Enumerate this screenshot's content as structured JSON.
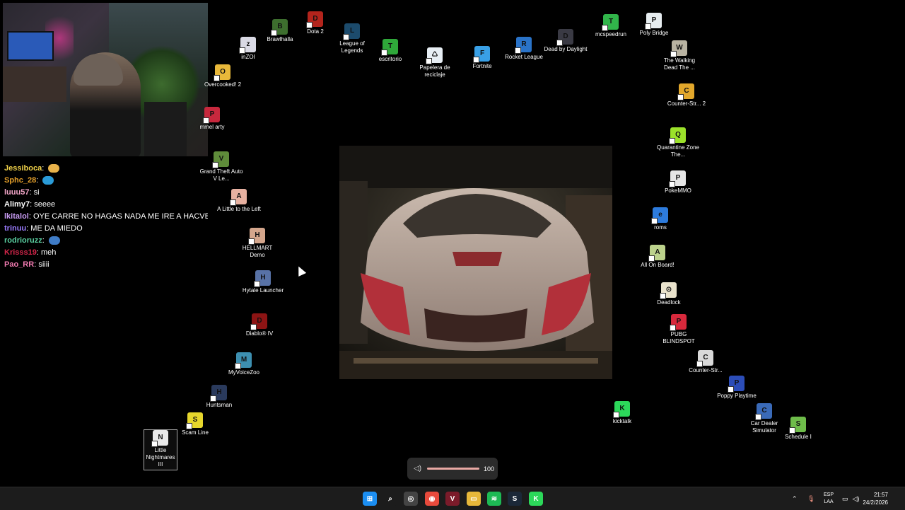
{
  "chat": [
    {
      "user": "Jessiboca",
      "color": "#f2d34a",
      "text": "",
      "emote": "#e8b24a"
    },
    {
      "user": "Sphc_28",
      "color": "#e8a22b",
      "text": "",
      "emote": "#2a9bd8"
    },
    {
      "user": "luuu57",
      "color": "#f3a6c8",
      "text": "si",
      "emote": ""
    },
    {
      "user": "Alimy7",
      "color": "#ffffff",
      "text": "seeee",
      "emote": ""
    },
    {
      "user": "lkitalol",
      "color": "#c99cf4",
      "text": "OYE CARRE NO HAGAS NADA ME IRE A HACVER ALG",
      "emote": ""
    },
    {
      "user": "trinuu",
      "color": "#9b7cff",
      "text": "ME DA MIEDO",
      "emote": ""
    },
    {
      "user": "rodrioruzz",
      "color": "#5bd2a3",
      "text": "",
      "emote": "#3f7cc7"
    },
    {
      "user": "Krisss19",
      "color": "#d6264b",
      "text": "meh",
      "emote": ""
    },
    {
      "user": "Pao_RR",
      "color": "#f07ab0",
      "text": "siiii",
      "emote": ""
    }
  ],
  "icons": [
    {
      "name": "icon-brawlhalla",
      "label": "Brawlhalla",
      "color": "#3d6e2e",
      "glyph": "B"
    },
    {
      "name": "icon-dota2",
      "label": "Dota 2",
      "color": "#b3241c",
      "glyph": "D"
    },
    {
      "name": "icon-inzoi",
      "label": "inZOI",
      "color": "#d9d9e4",
      "glyph": "z"
    },
    {
      "name": "icon-league",
      "label": "League of Legends",
      "color": "#1c4b6c",
      "glyph": "L"
    },
    {
      "name": "icon-escritorio",
      "label": "escritorio",
      "color": "#2fa83a",
      "glyph": "T"
    },
    {
      "name": "icon-papelera",
      "label": "Papelera de reciclaje",
      "color": "#e7eef4",
      "glyph": "♺"
    },
    {
      "name": "icon-fortnite",
      "label": "Fortnite",
      "color": "#39a0e6",
      "glyph": "F"
    },
    {
      "name": "icon-rocket-league",
      "label": "Rocket League",
      "color": "#2a73c8",
      "glyph": "R"
    },
    {
      "name": "icon-dead-by-daylight",
      "label": "Dead by Daylight",
      "color": "#3a3a44",
      "glyph": "D"
    },
    {
      "name": "icon-mcspeedrun",
      "label": "mcspeedrun",
      "color": "#31b54a",
      "glyph": "T"
    },
    {
      "name": "icon-poly-bridge",
      "label": "Poly Bridge",
      "color": "#e6ecef",
      "glyph": "P"
    },
    {
      "name": "icon-walking-dead",
      "label": "The Walking Dead The ...",
      "color": "#b9b3a2",
      "glyph": "W"
    },
    {
      "name": "icon-overcooked",
      "label": "Overcooked! 2",
      "color": "#e8b83a",
      "glyph": "O"
    },
    {
      "name": "icon-bimmel-party",
      "label": "mmel arty",
      "color": "#c7283d",
      "glyph": "P"
    },
    {
      "name": "icon-counter-strike-2",
      "label": "Counter-Str... 2",
      "color": "#e2a72b",
      "glyph": "C"
    },
    {
      "name": "icon-gta-v",
      "label": "Grand Theft Auto V Le...",
      "color": "#5f8c3a",
      "glyph": "V"
    },
    {
      "name": "icon-quarantine-zone",
      "label": "Quarantine Zone The...",
      "color": "#9be12a",
      "glyph": "Q"
    },
    {
      "name": "icon-pokemmo",
      "label": "PokeMMO",
      "color": "#e6e6e6",
      "glyph": "P"
    },
    {
      "name": "icon-little-left",
      "label": "A Little to the Left",
      "color": "#e7b1a1",
      "glyph": "A"
    },
    {
      "name": "icon-roms",
      "label": "roms",
      "color": "#2d7bdc",
      "glyph": "e"
    },
    {
      "name": "icon-hellmart",
      "label": "HELLMART Demo",
      "color": "#d4a68c",
      "glyph": "H"
    },
    {
      "name": "icon-all-on-board",
      "label": "All On Board!",
      "color": "#bcd28c",
      "glyph": "A"
    },
    {
      "name": "icon-hytale",
      "label": "Hytale Launcher",
      "color": "#5872a6",
      "glyph": "H"
    },
    {
      "name": "icon-deadlock",
      "label": "Deadlock",
      "color": "#e9e2cc",
      "glyph": "⊙"
    },
    {
      "name": "icon-diablo",
      "label": "Diablo® IV",
      "color": "#8c1414",
      "glyph": "D"
    },
    {
      "name": "icon-pubg",
      "label": "PUBG BLINDSPOT",
      "color": "#d8293c",
      "glyph": "P"
    },
    {
      "name": "icon-counter-strike",
      "label": "Counter-Str...",
      "color": "#d9d9d9",
      "glyph": "C"
    },
    {
      "name": "icon-myvoicezoo",
      "label": "MyVoiceZoo",
      "color": "#3d8fb0",
      "glyph": "M"
    },
    {
      "name": "icon-poppy-playtime",
      "label": "Poppy Playtime",
      "color": "#2c4db8",
      "glyph": "P"
    },
    {
      "name": "icon-huntsman",
      "label": "Huntsman",
      "color": "#2a3a5c",
      "glyph": "H"
    },
    {
      "name": "icon-kicktalk",
      "label": "kicktalk",
      "color": "#2cd85a",
      "glyph": "K"
    },
    {
      "name": "icon-car-dealer",
      "label": "Car Dealer Simulator",
      "color": "#3a6ab8",
      "glyph": "C"
    },
    {
      "name": "icon-scam-line",
      "label": "Scam Line",
      "color": "#e6d62c",
      "glyph": "S"
    },
    {
      "name": "icon-schedule-i",
      "label": "Schedule I",
      "color": "#6ebc4a",
      "glyph": "S"
    },
    {
      "name": "icon-little-nightmares",
      "label": "Little Nightmares III",
      "color": "#e9e9e9",
      "glyph": "N"
    }
  ],
  "volume": {
    "value": "100",
    "level": 1.0
  },
  "taskbar": {
    "apps": [
      {
        "name": "taskbar-start-button",
        "glyph": "⊞",
        "color": "#1b8ef2"
      },
      {
        "name": "taskbar-search-icon",
        "glyph": "⌕",
        "color": "#1c1c1c"
      },
      {
        "name": "taskbar-app-obs",
        "glyph": "◎",
        "color": "#444"
      },
      {
        "name": "taskbar-chrome-icon",
        "glyph": "◉",
        "color": "#e84a3c"
      },
      {
        "name": "taskbar-voicemeeter-icon",
        "glyph": "V",
        "color": "#7b1b2a"
      },
      {
        "name": "taskbar-file-explorer-icon",
        "glyph": "▭",
        "color": "#e8b83a"
      },
      {
        "name": "taskbar-spotify-icon",
        "glyph": "≋",
        "color": "#1db954"
      },
      {
        "name": "taskbar-steam-icon",
        "glyph": "S",
        "color": "#1b2838"
      },
      {
        "name": "taskbar-kick-icon",
        "glyph": "K",
        "color": "#2cd85a"
      }
    ],
    "language": "ESP",
    "layout": "LAA",
    "time": "21:57",
    "date": "24/2/2026"
  }
}
